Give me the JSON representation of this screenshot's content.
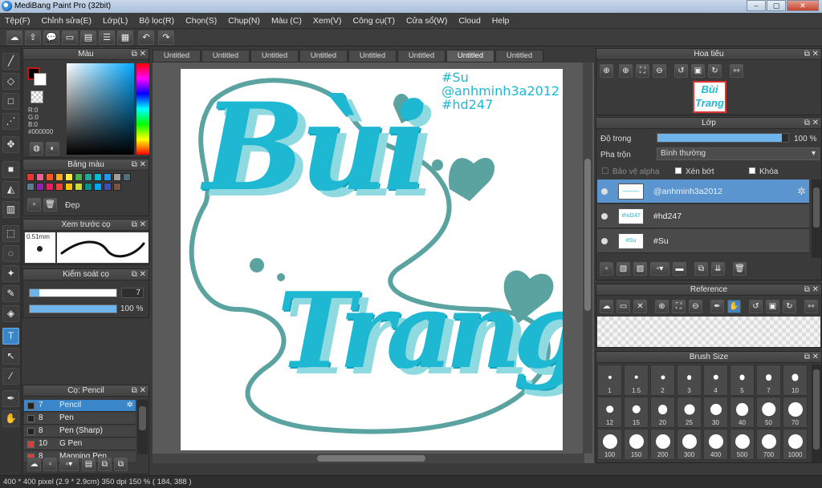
{
  "window": {
    "title": "MediBang Paint Pro (32bit)",
    "buttons": [
      "–",
      "▢",
      "✕"
    ]
  },
  "menu": [
    "Tệp(F)",
    "Chỉnh sửa(E)",
    "Lớp(L)",
    "Bộ lọc(R)",
    "Chọn(S)",
    "Chụp(N)",
    "Màu (C)",
    "Xem(V)",
    "Công cụ(T)",
    "Cửa sổ(W)",
    "Cloud",
    "Help"
  ],
  "toolbar_icons": [
    "cloud-icon",
    "share-icon",
    "comment-icon",
    "message-icon",
    "page-icon",
    "page-list-icon",
    "page-grid-icon",
    "undo-icon",
    "redo-icon"
  ],
  "tools": [
    "brush-icon",
    "eraser-icon",
    "rect-icon",
    "dot-brush-icon",
    "move-icon",
    "fill-rect-icon",
    "bucket-icon",
    "gradient-icon",
    "select-rect-icon",
    "lasso-icon",
    "magic-wand-icon",
    "select-pen-icon",
    "select-eraser-icon",
    "text-icon",
    "operation-icon",
    "eyedropper-icon",
    "dropper-icon",
    "hand-icon"
  ],
  "color_panel": {
    "title": "Màu",
    "r": "R:0",
    "g": "G:0",
    "b": "B:0",
    "hex": "#000000"
  },
  "palette_panel": {
    "title": "Bảng màu",
    "name": "Đẹp",
    "colors": [
      "#e53935",
      "#f06292",
      "#ff5722",
      "#ffa726",
      "#ffeb3b",
      "#4caf50",
      "#26a69a",
      "#00bcd4",
      "#2196f3",
      "#9e9e9e",
      "#546e7a",
      "#607d8b",
      "#8e24aa",
      "#e91e63",
      "#f44336",
      "#ffc107",
      "#cddc39",
      "#009688",
      "#03a9f4",
      "#3f51b5",
      "#795548"
    ]
  },
  "preview_panel": {
    "title": "Xem trước cọ",
    "size": "0.51mm"
  },
  "brush_control": {
    "title": "Kiểm soát cọ",
    "size_value": "7",
    "opacity_value": "100 %"
  },
  "brush_list": {
    "title": "Cọ: Pencil",
    "items": [
      {
        "size": "7",
        "name": "Pencil",
        "color": "#222222"
      },
      {
        "size": "8",
        "name": "Pen",
        "color": "#222222"
      },
      {
        "size": "8",
        "name": "Pen (Sharp)",
        "color": "#222222"
      },
      {
        "size": "10",
        "name": "G Pen",
        "color": "#e53935"
      },
      {
        "size": "8",
        "name": "Mapping Pen",
        "color": "#e53935"
      }
    ]
  },
  "tabs": [
    "Untitled",
    "Untitled",
    "Untitled",
    "Untitled",
    "Untitled",
    "Untitled",
    "Untitled",
    "Untitled"
  ],
  "canvas_text": {
    "tag1": "#Su",
    "tag2": "@anhminh3a2012",
    "tag3": "#hd247",
    "word1": "Bùi",
    "word2": "Trang"
  },
  "navigator": {
    "title": "Hoa tiêu"
  },
  "layer_panel": {
    "title": "Lớp",
    "opacity_label": "Độ trong",
    "opacity_value": "100 %",
    "opacity_fraction": 0.95,
    "blend_label": "Pha trộn",
    "blend_value": "Bình thường",
    "protect_alpha": "Bảo vệ alpha",
    "clipping": "Xén bớt",
    "lock": "Khóa",
    "layers": [
      {
        "name": "@anhminh3a2012",
        "thumb": "———",
        "selected": true
      },
      {
        "name": "#hd247",
        "thumb": "#hd247",
        "selected": false
      },
      {
        "name": "#Su",
        "thumb": "#Su",
        "selected": false
      }
    ]
  },
  "reference_panel": {
    "title": "Reference"
  },
  "brush_size_panel": {
    "title": "Brush Size",
    "sizes": [
      "1",
      "1.5",
      "2",
      "3",
      "4",
      "5",
      "7",
      "10",
      "12",
      "15",
      "20",
      "25",
      "30",
      "40",
      "50",
      "70",
      "100",
      "150",
      "200",
      "300",
      "400",
      "500",
      "700",
      "1000"
    ]
  },
  "status": {
    "text": "400 * 400 pixel  (2.9 * 2.9cm)  350 dpi  150 %  ( 184, 388 )"
  },
  "colors": {
    "accent": "#3a86c8",
    "lettering": "#1fb8d2",
    "shadow": "#8fd9e0",
    "outline": "#5aa3a0"
  }
}
